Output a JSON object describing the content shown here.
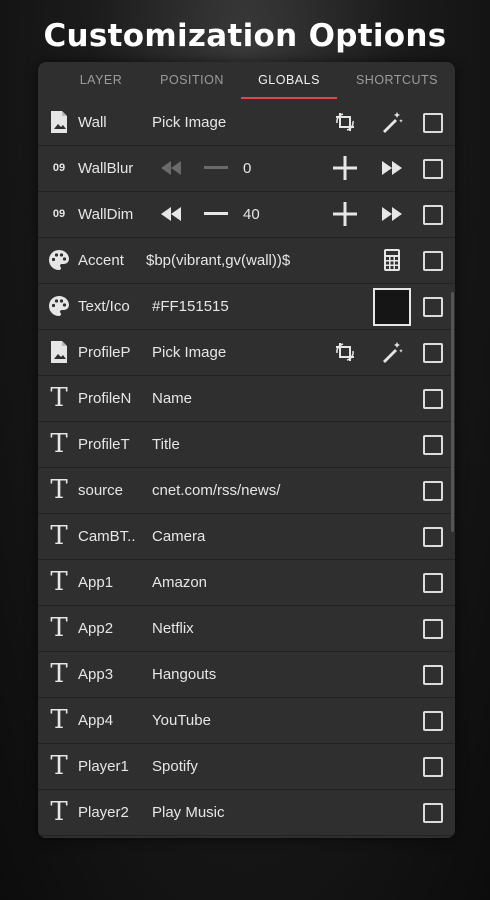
{
  "header": {
    "title": "Customization Options"
  },
  "tabs": [
    {
      "label": "LAYER",
      "active": false
    },
    {
      "label": "POSITION",
      "active": false
    },
    {
      "label": "GLOBALS",
      "active": true
    },
    {
      "label": "SHORTCUTS",
      "active": false
    }
  ],
  "rows": [
    {
      "icon": "image-icon",
      "label": "Wall",
      "value": "Pick Image",
      "controls": [
        "crop-rotate-icon",
        "magic-wand-icon"
      ]
    },
    {
      "icon": "number-icon",
      "label": "WallBlur",
      "value": "0",
      "controls": [
        "rewind-icon",
        "minus-icon",
        "plus-icon",
        "fast-forward-icon"
      ],
      "disabled_controls": true
    },
    {
      "icon": "number-icon",
      "label": "WallDim",
      "value": "40",
      "controls": [
        "rewind-icon",
        "minus-icon",
        "plus-icon",
        "fast-forward-icon"
      ]
    },
    {
      "icon": "palette-icon",
      "label": "Accent",
      "value": "$bp(vibrant,gv(wall))$",
      "controls": [
        "calculator-icon"
      ]
    },
    {
      "icon": "palette-icon",
      "label": "Text/Ico",
      "value": "#FF151515",
      "controls": [
        "color-swatch"
      ]
    },
    {
      "icon": "image-icon",
      "label": "ProfileP",
      "value": "Pick Image",
      "controls": [
        "crop-rotate-icon",
        "magic-wand-icon"
      ]
    },
    {
      "icon": "text-icon",
      "label": "ProfileN",
      "value": "Name"
    },
    {
      "icon": "text-icon",
      "label": "ProfileT",
      "value": "Title"
    },
    {
      "icon": "text-icon",
      "label": "source",
      "value": "cnet.com/rss/news/"
    },
    {
      "icon": "text-icon",
      "label": "CamBT..",
      "value": "Camera"
    },
    {
      "icon": "text-icon",
      "label": "App1",
      "value": "Amazon"
    },
    {
      "icon": "text-icon",
      "label": "App2",
      "value": "Netflix"
    },
    {
      "icon": "text-icon",
      "label": "App3",
      "value": "Hangouts"
    },
    {
      "icon": "text-icon",
      "label": "App4",
      "value": "YouTube"
    },
    {
      "icon": "text-icon",
      "label": "Player1",
      "value": "Spotify"
    },
    {
      "icon": "text-icon",
      "label": "Player2",
      "value": "Play Music"
    }
  ],
  "icon_glyphs": {
    "number": "09",
    "text": "T"
  },
  "colors": {
    "accent_underline": "#d84a4a",
    "panel_bg": "#2f2f2f",
    "swatch": "#151515"
  }
}
